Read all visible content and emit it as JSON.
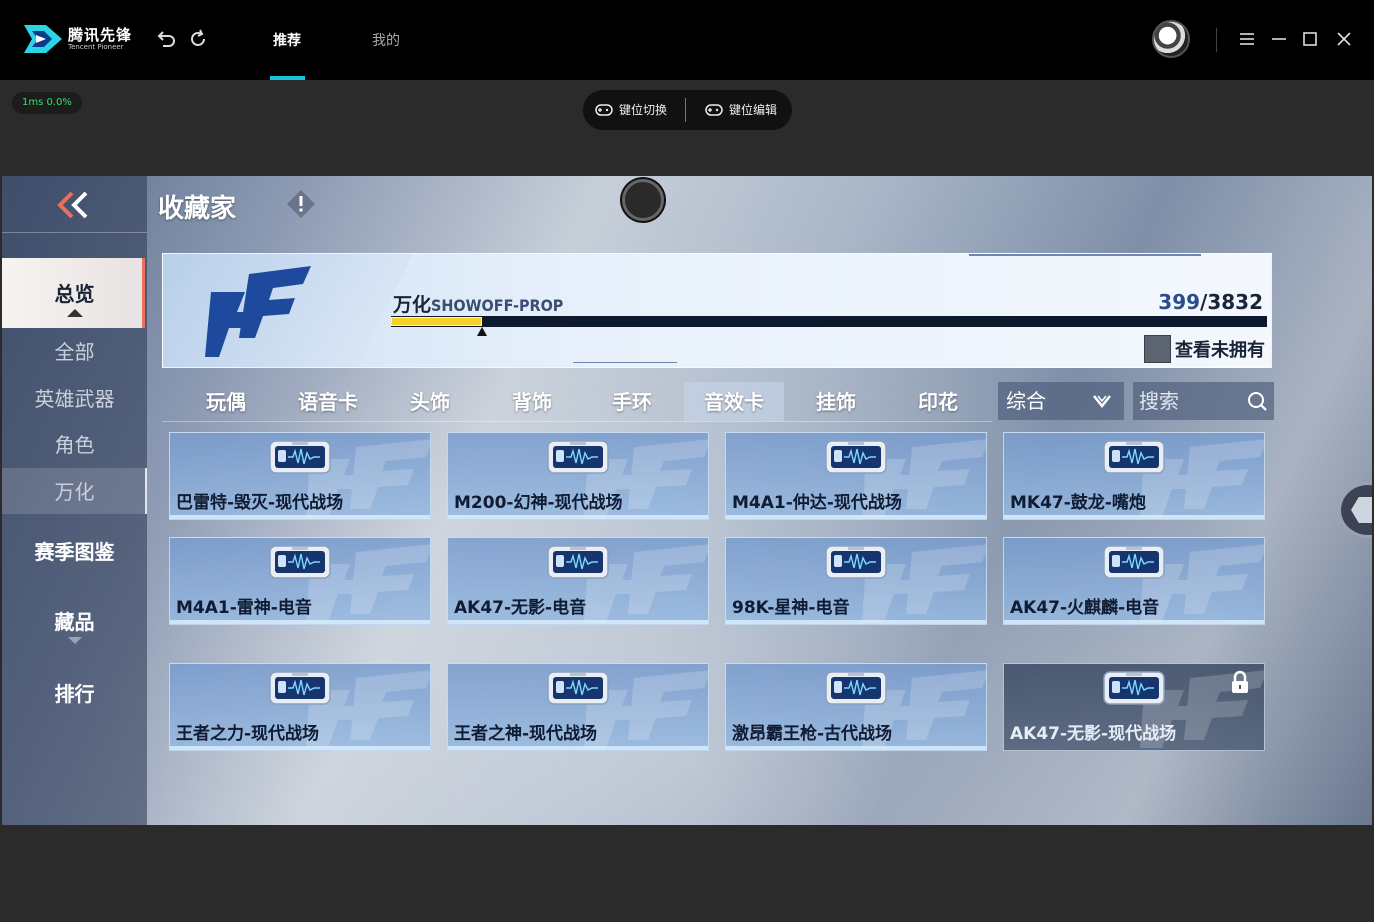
{
  "app": {
    "brand_cn": "腾讯先锋",
    "brand_en": "Tencent Pioneer",
    "tabs": [
      {
        "label": "推荐",
        "active": true
      },
      {
        "label": "我的",
        "active": false
      }
    ],
    "accent_color": "#19c4d6"
  },
  "overlay": {
    "stats": "1ms  0.0%",
    "key_switch": "键位切换",
    "key_edit": "键位编辑"
  },
  "game": {
    "page_title": "收藏家",
    "sidebar": {
      "overview": "总览",
      "all": "全部",
      "hero_weapons": "英雄武器",
      "roles": "角色",
      "wanhua": "万化",
      "season_atlas": "赛季图鉴",
      "collection": "藏品",
      "ranking": "排行"
    },
    "banner": {
      "label_cn": "万化",
      "label_en": "SHOWOFF-PROP",
      "current": "399",
      "total": "/3832",
      "progress_fraction": 0.104,
      "show_unowned": "查看未拥有"
    },
    "categories": [
      {
        "label": "玩偶",
        "active": false
      },
      {
        "label": "语音卡",
        "active": false
      },
      {
        "label": "头饰",
        "active": false
      },
      {
        "label": "背饰",
        "active": false
      },
      {
        "label": "手环",
        "active": false
      },
      {
        "label": "音效卡",
        "active": true
      },
      {
        "label": "挂饰",
        "active": false
      },
      {
        "label": "印花",
        "active": false
      }
    ],
    "sort_value": "综合",
    "search_placeholder": "搜索",
    "items": [
      {
        "label": "巴雷特-毁灭-现代战场",
        "locked": false
      },
      {
        "label": "M200-幻神-现代战场",
        "locked": false
      },
      {
        "label": "M4A1-仲达-现代战场",
        "locked": false
      },
      {
        "label": "MK47-鼓龙-嘴炮",
        "locked": false
      },
      {
        "label": "M4A1-雷神-电音",
        "locked": false
      },
      {
        "label": "AK47-无影-电音",
        "locked": false
      },
      {
        "label": "98K-星神-电音",
        "locked": false
      },
      {
        "label": "AK47-火麒麟-电音",
        "locked": false
      },
      {
        "label": "王者之力-现代战场",
        "locked": false
      },
      {
        "label": "王者之神-现代战场",
        "locked": false
      },
      {
        "label": "激昂霸王枪-古代战场",
        "locked": false
      },
      {
        "label": "AK47-无影-现代战场",
        "locked": true
      }
    ]
  }
}
